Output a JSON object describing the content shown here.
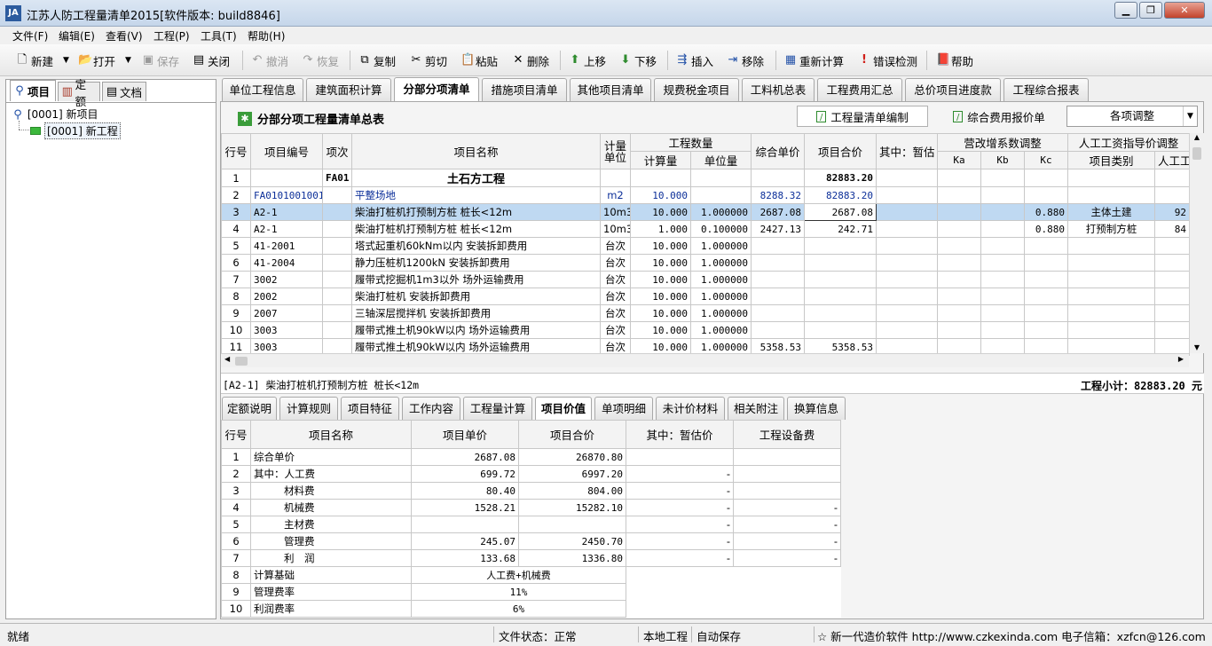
{
  "window": {
    "title": "江苏人防工程量清单2015[软件版本: build8846]",
    "icon_text": "JA"
  },
  "menu": [
    "文件(F)",
    "编辑(E)",
    "查看(V)",
    "工程(P)",
    "工具(T)",
    "帮助(H)"
  ],
  "toolbar": {
    "new": "新建",
    "open": "打开",
    "save": "保存",
    "close": "关闭",
    "undo": "撤消",
    "redo": "恢复",
    "copy": "复制",
    "cut": "剪切",
    "paste": "粘贴",
    "delete": "删除",
    "move_up": "上移",
    "move_down": "下移",
    "insert": "插入",
    "remove": "移除",
    "recalc": "重新计算",
    "error_check": "错误检测",
    "help": "帮助"
  },
  "left_tabs": [
    "项目",
    "定额",
    "文档"
  ],
  "tree": {
    "root": "[0001] 新项目",
    "child": "[0001] 新工程"
  },
  "main_tabs": [
    "单位工程信息",
    "建筑面积计算",
    "分部分项清单",
    "措施项目清单",
    "其他项目清单",
    "规费税金项目",
    "工料机总表",
    "工程费用汇总",
    "总价项目进度款",
    "工程综合报表"
  ],
  "section_title": "分部分项工程量清单总表",
  "sub_tabs": [
    "工程量清单编制",
    "综合费用报价单"
  ],
  "combo_value": "各项调整",
  "grid": {
    "headers": {
      "row_no": "行号",
      "code": "项目编号",
      "item": "项次",
      "name": "项目名称",
      "unit": "计量单位",
      "qty_group": "工程数量",
      "qty_calc": "计算量",
      "qty_unit": "单位量",
      "unit_price": "综合单价",
      "total": "项目合价",
      "est": "其中：暂估",
      "vat_group": "营改增系数调整",
      "ka": "Ka",
      "kb": "Kb",
      "kc": "Kc",
      "labor_group": "人工工资指导价调整",
      "category": "项目类别",
      "labor": "人工工"
    },
    "rows": [
      {
        "no": "1",
        "code": "",
        "item": "FA01",
        "name": "土石方工程",
        "unit": "",
        "calc": "",
        "uq": "",
        "price": "",
        "total": "82883.20",
        "kc": "",
        "cat": "",
        "labor": "",
        "type": "group"
      },
      {
        "no": "2",
        "code": "FA0101001001",
        "item": "",
        "name": "平整场地",
        "unit": "m2",
        "calc": "10.000",
        "uq": "",
        "price": "8288.32",
        "total": "82883.20",
        "kc": "",
        "cat": "",
        "labor": "",
        "type": "list"
      },
      {
        "no": "3",
        "code": "A2-1",
        "item": "",
        "name": "柴油打桩机打预制方桩 桩长<12m",
        "unit": "10m3",
        "calc": "10.000",
        "uq": "1.000000",
        "price": "2687.08",
        "total": "2687.08",
        "kc": "0.880",
        "cat": "主体土建",
        "labor": "92",
        "type": "sel"
      },
      {
        "no": "4",
        "code": "A2-1",
        "item": "",
        "name": "柴油打桩机打预制方桩 桩长<12m",
        "unit": "10m3",
        "calc": "1.000",
        "uq": "0.100000",
        "price": "2427.13",
        "total": "242.71",
        "kc": "0.880",
        "cat": "打预制方桩",
        "labor": "84",
        "type": ""
      },
      {
        "no": "5",
        "code": "41-2001",
        "item": "",
        "name": "塔式起重机60kNm以内 安装拆卸费用",
        "unit": "台次",
        "calc": "10.000",
        "uq": "1.000000",
        "price": "",
        "total": "",
        "kc": "",
        "cat": "",
        "labor": "",
        "type": ""
      },
      {
        "no": "6",
        "code": "41-2004",
        "item": "",
        "name": "静力压桩机1200kN 安装拆卸费用",
        "unit": "台次",
        "calc": "10.000",
        "uq": "1.000000",
        "price": "",
        "total": "",
        "kc": "",
        "cat": "",
        "labor": "",
        "type": ""
      },
      {
        "no": "7",
        "code": "3002",
        "item": "",
        "name": "履带式挖掘机1m3以外 场外运输费用",
        "unit": "台次",
        "calc": "10.000",
        "uq": "1.000000",
        "price": "",
        "total": "",
        "kc": "",
        "cat": "",
        "labor": "",
        "type": ""
      },
      {
        "no": "8",
        "code": "2002",
        "item": "",
        "name": "柴油打桩机 安装拆卸费用",
        "unit": "台次",
        "calc": "10.000",
        "uq": "1.000000",
        "price": "",
        "total": "",
        "kc": "",
        "cat": "",
        "labor": "",
        "type": ""
      },
      {
        "no": "9",
        "code": "2007",
        "item": "",
        "name": "三轴深层搅拌机 安装拆卸费用",
        "unit": "台次",
        "calc": "10.000",
        "uq": "1.000000",
        "price": "",
        "total": "",
        "kc": "",
        "cat": "",
        "labor": "",
        "type": ""
      },
      {
        "no": "10",
        "code": "3003",
        "item": "",
        "name": "履带式推土机90kW以内 场外运输费用",
        "unit": "台次",
        "calc": "10.000",
        "uq": "1.000000",
        "price": "",
        "total": "",
        "kc": "",
        "cat": "",
        "labor": "",
        "type": ""
      },
      {
        "no": "11",
        "code": "3003",
        "item": "",
        "name": "履带式推土机90kW以内 场外运输费用",
        "unit": "台次",
        "calc": "10.000",
        "uq": "1.000000",
        "price": "5358.53",
        "total": "5358.53",
        "kc": "",
        "cat": "",
        "labor": "",
        "type": ""
      }
    ]
  },
  "info_bar": {
    "left": "[A2-1] 柴油打桩机打预制方桩 桩长<12m",
    "right": "工程小计：82883.20 元"
  },
  "bottom_tabs": [
    "定额说明",
    "计算规则",
    "项目特征",
    "工作内容",
    "工程量计算",
    "项目价值",
    "单项明细",
    "未计价材料",
    "相关附注",
    "换算信息"
  ],
  "value_grid": {
    "headers": {
      "no": "行号",
      "name": "项目名称",
      "price": "项目单价",
      "total": "项目合价",
      "est": "其中：暂估价",
      "equip": "工程设备费"
    },
    "rows": [
      {
        "no": "1",
        "name": "综合单价",
        "price": "2687.08",
        "total": "26870.80",
        "est": "",
        "equip": ""
      },
      {
        "no": "2",
        "name": "其中：人工费",
        "price": "699.72",
        "total": "6997.20",
        "est": "-",
        "equip": ""
      },
      {
        "no": "3",
        "name": "材料费",
        "price": "80.40",
        "total": "804.00",
        "est": "-",
        "equip": ""
      },
      {
        "no": "4",
        "name": "机械费",
        "price": "1528.21",
        "total": "15282.10",
        "est": "-",
        "equip": "-"
      },
      {
        "no": "5",
        "name": "主材费",
        "price": "",
        "total": "",
        "est": "-",
        "equip": "-"
      },
      {
        "no": "6",
        "name": "管理费",
        "price": "245.07",
        "total": "2450.70",
        "est": "-",
        "equip": "-"
      },
      {
        "no": "7",
        "name": "利　润",
        "price": "133.68",
        "total": "1336.80",
        "est": "-",
        "equip": "-"
      },
      {
        "no": "8",
        "name": "计算基础",
        "merged": "人工费+机械费"
      },
      {
        "no": "9",
        "name": "管理费率",
        "merged": "11%"
      },
      {
        "no": "10",
        "name": "利润费率",
        "merged": "6%"
      }
    ]
  },
  "status": {
    "ready": "就绪",
    "file_state": "文件状态：正常",
    "local": "本地工程",
    "autosave": "自动保存",
    "promo": "☆ 新一代造价软件 http://www.czkexinda.com 电子信箱：xzfcn@126.com"
  },
  "colors": {
    "selected_row": "#bfd9f2",
    "link_blue": "#0c2f99",
    "section_green": "#3a9c3a"
  }
}
